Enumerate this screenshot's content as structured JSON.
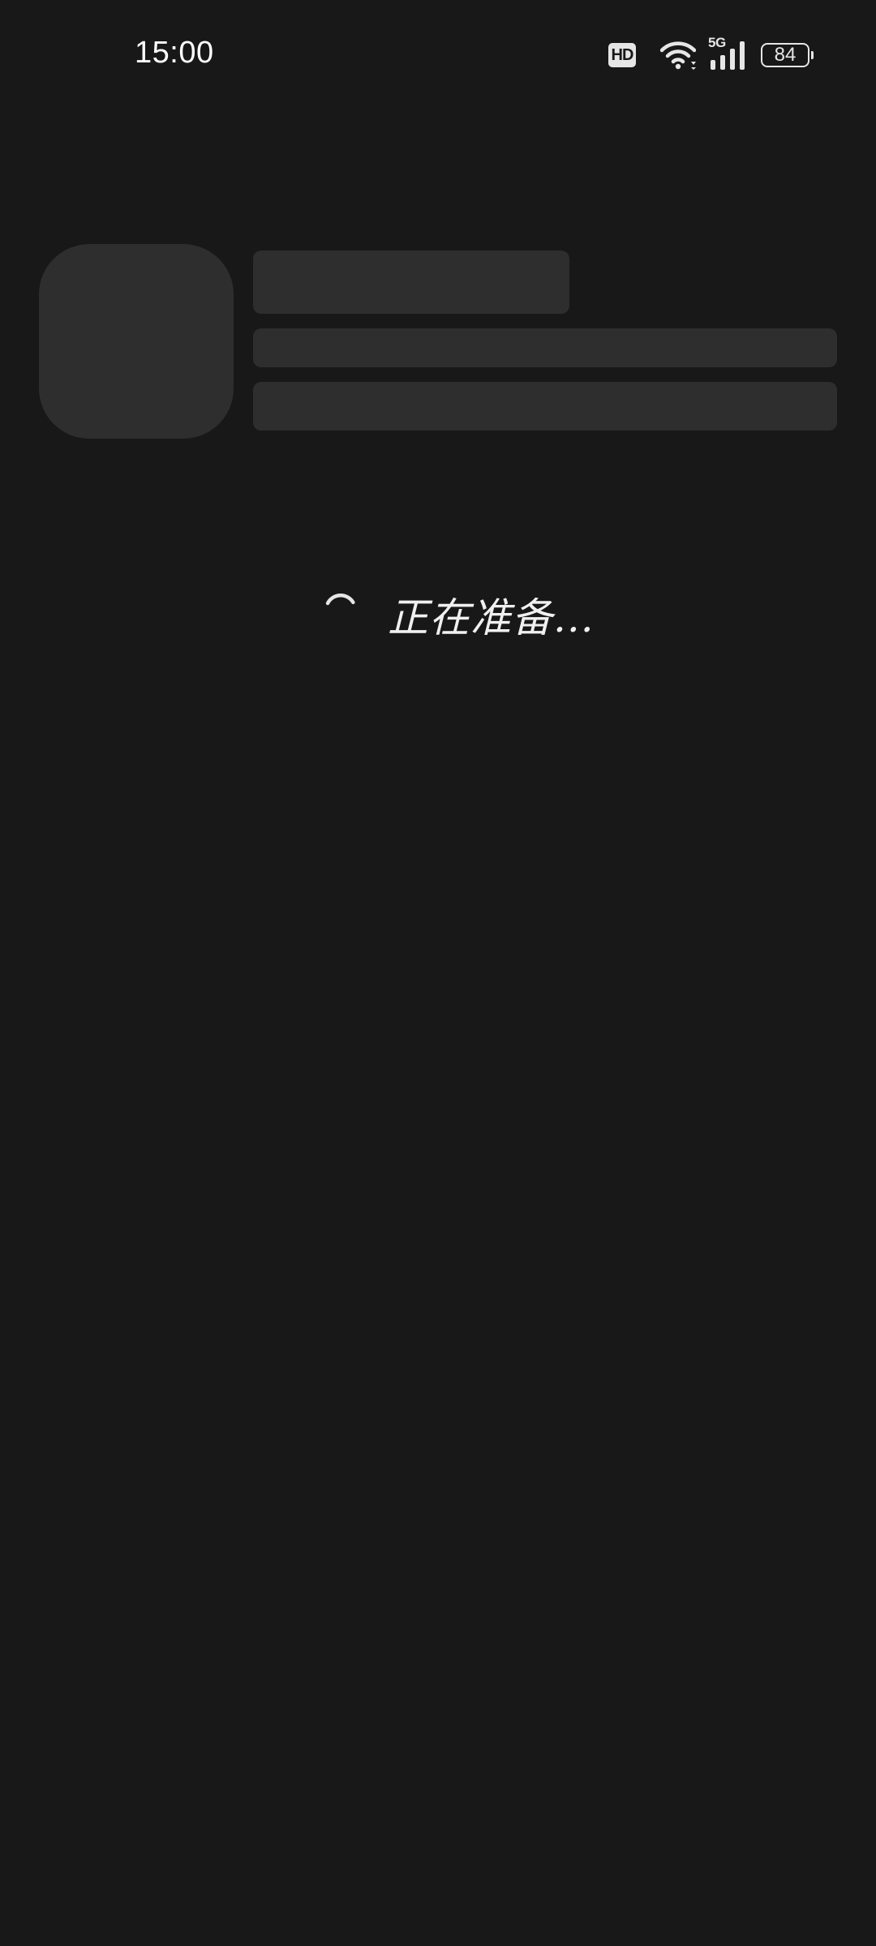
{
  "status_bar": {
    "time": "15:00",
    "hd_label": "HD",
    "network_label": "5G",
    "battery_level": "84"
  },
  "loading": {
    "text": "正在准备..."
  },
  "colors": {
    "background": "#181818",
    "skeleton": "#2e2e2e",
    "text": "#ffffff"
  },
  "icons": [
    "hd-icon",
    "wifi-icon",
    "signal-icon",
    "battery-icon",
    "spinner-icon"
  ]
}
